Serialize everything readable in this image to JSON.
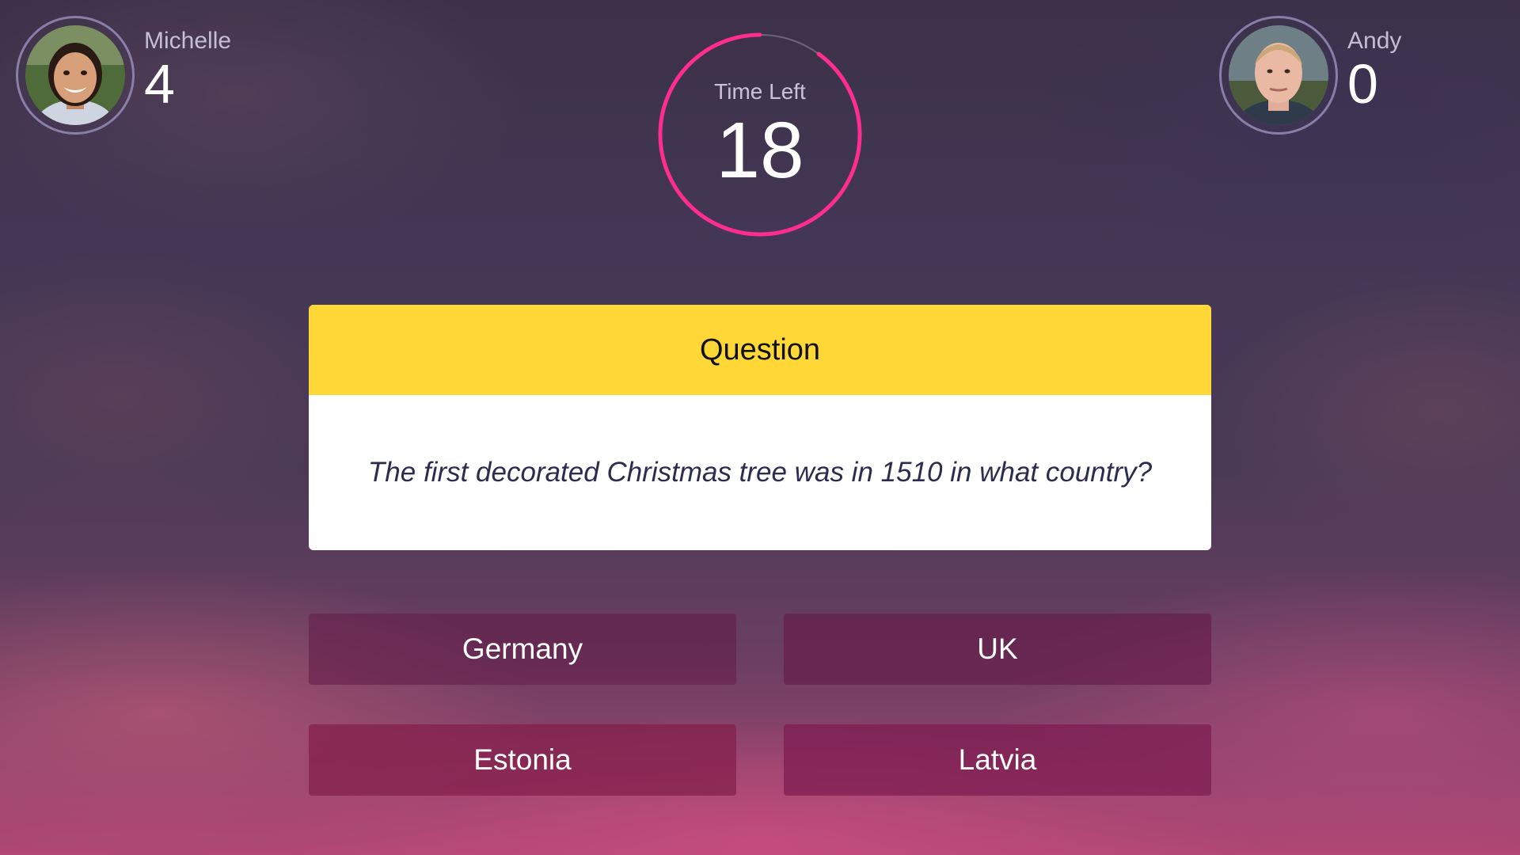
{
  "players": [
    {
      "name": "Michelle",
      "score": "4"
    },
    {
      "name": "Andy",
      "score": "0"
    }
  ],
  "timer": {
    "label": "Time Left",
    "value": "18",
    "remaining_fraction": 0.9,
    "ring_color": "#ff2d8f"
  },
  "question": {
    "header": "Question",
    "text": "The first decorated Christmas tree was in 1510 in what country?",
    "header_color": "#ffd737"
  },
  "answers": [
    {
      "label": "Germany"
    },
    {
      "label": "UK"
    },
    {
      "label": "Estonia"
    },
    {
      "label": "Latvia"
    }
  ]
}
